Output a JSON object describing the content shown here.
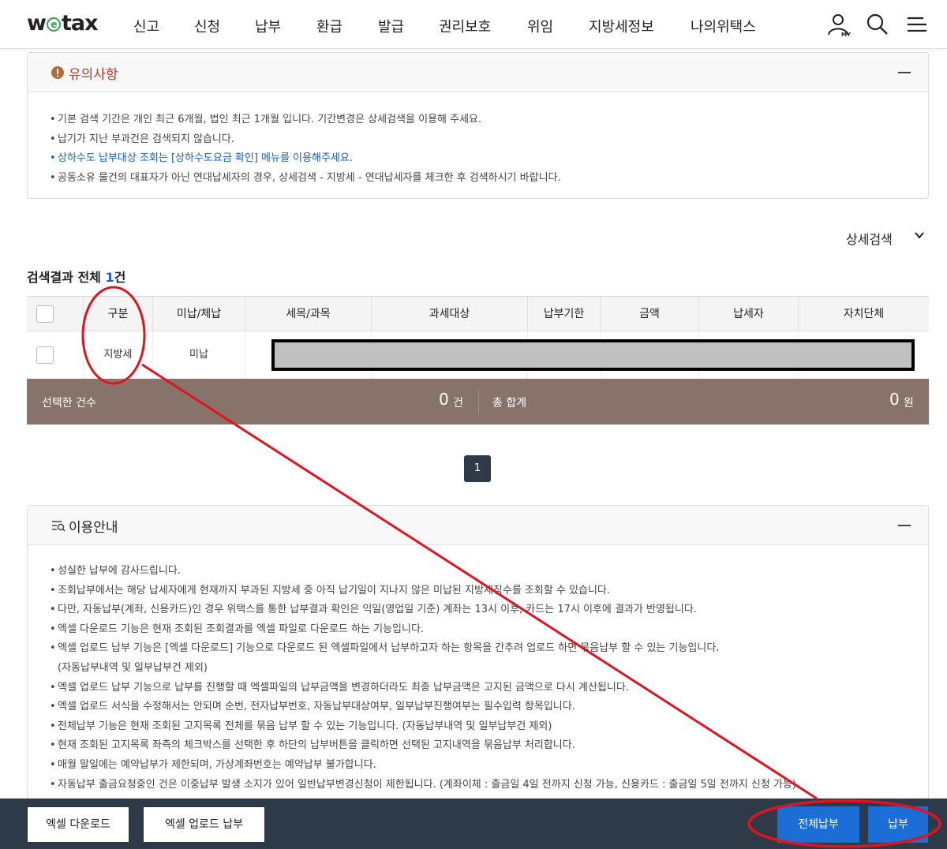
{
  "header": {
    "logo": "wetax",
    "logo_pre": "w",
    "logo_e": "e",
    "logo_post": "tax",
    "nav": [
      "신고",
      "신청",
      "납부",
      "환급",
      "발급",
      "권리보호",
      "위임",
      "지방세정보",
      "나의위택스"
    ],
    "my_badge": "MY"
  },
  "notice": {
    "title": "유의사항",
    "items": [
      "기본 검색 기간은 개인 최근 6개월, 법인 최근 1개월 입니다. 기간변경은 상세검색을 이용해 주세요.",
      "납기가 지난 부과건은 검색되지 않습니다.",
      "상하수도 납부대상 조회는 [상하수도요금 확인] 메뉴를 이용해주세요.",
      "공동소유 물건의 대표자가 아닌 연대납세자의 경우, 상세검색 - 지방세 - 연대납세자를 체크한 후 검색하시기 바랍니다."
    ]
  },
  "detail_search": "상세검색",
  "result": {
    "prefix": "검색결과 전체 ",
    "count": "1",
    "suffix": "건"
  },
  "table": {
    "headers": [
      "구분",
      "미납/체납",
      "세목/과목",
      "과세대상",
      "납부기한",
      "금액",
      "납세자",
      "자치단체"
    ],
    "rows": [
      {
        "type": "지방세",
        "status": "미납"
      }
    ]
  },
  "summary": {
    "selected_label": "선택한 건수",
    "selected_value": "0",
    "selected_unit": "건",
    "total_label": "총 합계",
    "total_value": "0",
    "total_unit": "원"
  },
  "pagination": {
    "current": "1"
  },
  "guide": {
    "title": "이용안내",
    "items": [
      "성실한 납부에 감사드립니다.",
      "조회납부에서는 해당 납세자에게 현재까지 부과된 지방세 중 아직 납기일이 지나지 않은 미납된 지방세징수를 조회할 수 있습니다.",
      "다만, 자동납부(계좌, 신용카드)인 경우 위택스를 통한 납부결과 확인은 익일(영업일 기준) 계좌는 13시 이후, 카드는 17시 이후에 결과가 반영됩니다.",
      "엑셀 다운로드 기능은 현재 조회된 조회결과를 엑셀 파일로 다운로드 하는 기능입니다.",
      "엑셀 업로드 납부 기능은 [엑셀 다운로드] 기능으로 다운로드 된 엑셀파일에서 납부하고자 하는 항목을 간추려 업로드 하면 묶음납부 할 수 있는 기능입니다.",
      "(자동납부내역 및 일부납부건 제외)",
      "엑셀 업로드 납부 기능으로 납부를 진행할 때 엑셀파일의 납부금액을 변경하더라도 최종 납부금액은 고지된 금액으로 다시 계산됩니다.",
      "엑셀 업로드 서식을 수정해서는 안되며 순번, 전자납부번호, 자동납부대상여부, 일부납부진행여부는 필수입력 항목입니다.",
      "전체납부 기능은 현재 조회된 고지목록 전체를 묶음 납부 할 수 있는 기능입니다. (자동납부내역 및 일부납부건 제외)",
      "현재 조회된 고지목록 좌측의 체크박스를 선택한 후 하단의 납부버튼을 클릭하면 선택된 고지내역을 묶음납부 처리합니다.",
      "매월 말일에는 예약납부가 제한되며, 가상계좌번호는 예약납부 불가합니다.",
      "자동납부 출금요청중인 건은 이중납부 발생 소지가 있어 일반납부변경신청이 제한됩니다. (계좌이체 : 출금일 4일 전까지 신청 가능, 신용카드 : 출금일 5일 전까지 신청 가능)"
    ]
  },
  "footer": {
    "excel_download": "엑셀 다운로드",
    "excel_upload": "엑셀 업로드 납부",
    "pay_all": "전체납부",
    "pay": "납부"
  },
  "colors": {
    "accent_blue": "#1a6ed6",
    "summary_bg": "#877369",
    "annotation_red": "#e0141e",
    "notice_title": "#c0392b"
  }
}
